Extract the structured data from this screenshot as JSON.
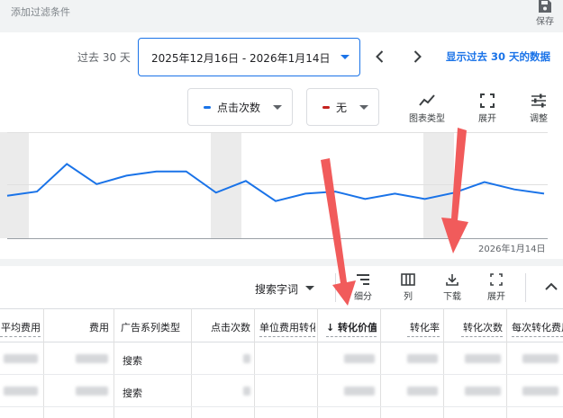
{
  "filter_bar": {
    "add_filter": "添加过滤条件",
    "save_label": "保存"
  },
  "date_range": {
    "preset": "过去 30 天",
    "range": "2025年12月16日 - 2026年1月14日",
    "show_link": "显示过去 30 天的数据"
  },
  "metrics": [
    {
      "label": "点击次数",
      "color": "#1a73e8"
    },
    {
      "label": "无",
      "color": "#c5221f"
    }
  ],
  "chart_tools": {
    "chart_type": "图表类型",
    "expand": "展开",
    "adjust": "调整"
  },
  "chart_data": {
    "type": "line",
    "x_end_label": "2026年1月14日",
    "series": [
      {
        "values": [
          0.4,
          0.44,
          0.7,
          0.51,
          0.59,
          0.63,
          0.63,
          0.43,
          0.54,
          0.35,
          0.42,
          0.44,
          0.37,
          0.42,
          0.37,
          0.43,
          0.53,
          0.46,
          0.42
        ]
      }
    ],
    "color": "#1a73e8",
    "grid": true
  },
  "table_toolbar": {
    "search_term": "搜索字词",
    "breakdown": "细分",
    "columns": "列",
    "download": "下载",
    "expand": "展开"
  },
  "table": {
    "headers": [
      "平均费用",
      "费用",
      "广告系列类型",
      "点击次数",
      "单位费用转化",
      "↓ 转化价值",
      "转化率",
      "转化次数",
      "每次转化费用"
    ],
    "rows": [
      {
        "campaign_type": "搜索"
      },
      {
        "campaign_type": "搜索"
      }
    ]
  },
  "accent_color": "#1a73e8",
  "annotation_color": "#f15b5b"
}
